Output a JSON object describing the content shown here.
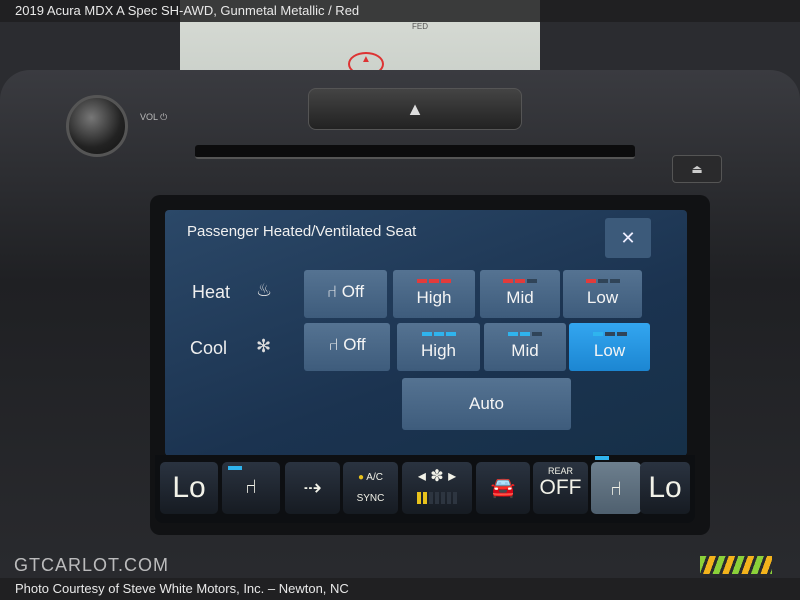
{
  "caption_top": "2019 Acura MDX A Spec SH-AWD,  Gunmetal Metallic / Red",
  "caption_bottom": "Photo Courtesy of Steve White Motors, Inc. – Newton, NC",
  "watermark": "GTCARLOT.COM",
  "map_label": "FED",
  "knob_label": "VOL ⏻",
  "screen": {
    "title": "Passenger Heated/Ventilated Seat",
    "close": "✕",
    "heat": {
      "label": "Heat",
      "off": "Off",
      "levels": [
        {
          "label": "High",
          "bars": 3
        },
        {
          "label": "Mid",
          "bars": 2
        },
        {
          "label": "Low",
          "bars": 1
        }
      ]
    },
    "cool": {
      "label": "Cool",
      "off": "Off",
      "levels": [
        {
          "label": "High",
          "bars": 3
        },
        {
          "label": "Mid",
          "bars": 2
        },
        {
          "label": "Low",
          "bars": 1,
          "selected": true
        }
      ]
    },
    "auto": "Auto"
  },
  "climate": {
    "left_temp": "Lo",
    "ac": "A/C",
    "sync": "SYNC",
    "rear": "REAR",
    "rear_state": "OFF",
    "right_temp": "Lo",
    "fan_level": 2,
    "fan_max": 7
  },
  "colors": {
    "heat": "#e23b3b",
    "cool": "#2fb4ee",
    "selected": "#1c86d2",
    "ac_indicator": "#e8c21c"
  }
}
